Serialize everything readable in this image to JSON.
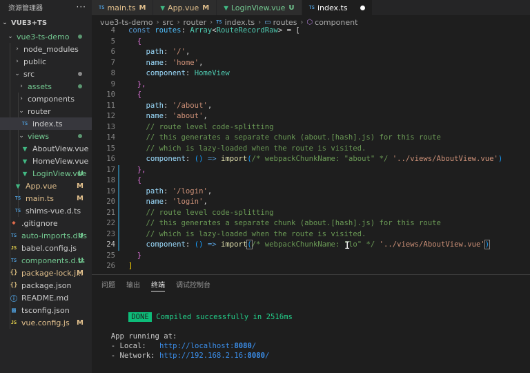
{
  "explorer": {
    "title": "资源管理器",
    "more": "···",
    "project": "VUE3+TS",
    "items": [
      {
        "label": "vue3-ts-demo",
        "status": "dot-green"
      },
      {
        "label": "node_modules"
      },
      {
        "label": "public"
      },
      {
        "label": "src",
        "status": "dot-gray"
      },
      {
        "label": "assets",
        "status": "dot-green"
      },
      {
        "label": "components"
      },
      {
        "label": "router"
      },
      {
        "label": "index.ts",
        "icon": "TS"
      },
      {
        "label": "views",
        "status": "dot-green"
      },
      {
        "label": "AboutView.vue"
      },
      {
        "label": "HomeView.vue"
      },
      {
        "label": "LoginView.vue",
        "badge": "U"
      },
      {
        "label": "App.vue",
        "badge": "M"
      },
      {
        "label": "main.ts",
        "icon": "TS",
        "badge": "M"
      },
      {
        "label": "shims-vue.d.ts",
        "icon": "TS"
      },
      {
        "label": ".gitignore"
      },
      {
        "label": "auto-imports.d.ts",
        "icon": "TS",
        "badge": "U"
      },
      {
        "label": "babel.config.js",
        "icon": "JS"
      },
      {
        "label": "components.d.ts",
        "icon": "TS",
        "badge": "U"
      },
      {
        "label": "package-lock.j...",
        "icon": "{}",
        "badge": "M"
      },
      {
        "label": "package.json",
        "icon": "{}"
      },
      {
        "label": "README.md"
      },
      {
        "label": "tsconfig.json"
      },
      {
        "label": "vue.config.js",
        "icon": "JS",
        "badge": "M"
      }
    ]
  },
  "tabs": [
    {
      "label": "main.ts",
      "icon": "TS",
      "badge": "M"
    },
    {
      "label": "App.vue",
      "badge": "M"
    },
    {
      "label": "LoginView.vue",
      "badge": "U"
    },
    {
      "label": "index.ts",
      "icon": "TS",
      "active": true
    }
  ],
  "breadcrumb": [
    "vue3-ts-demo",
    "src",
    "router",
    "index.ts",
    "routes",
    "component"
  ],
  "code": {
    "line_numbers": [
      "4",
      "5",
      "6",
      "7",
      "8",
      "9",
      "10",
      "11",
      "12",
      "13",
      "14",
      "15",
      "16",
      "17",
      "18",
      "19",
      "20",
      "21",
      "22",
      "23",
      "24",
      "25",
      "26"
    ],
    "lines": {
      "l4_a": "const",
      "l4_b": "routes",
      "l4_c": ": ",
      "l4_d": "Array",
      "l4_e": "<",
      "l4_f": "RouteRecordRaw",
      "l4_g": "> = [",
      "l5": "{",
      "l6_k": "path",
      "l6_v": "'/'",
      "l7_k": "name",
      "l7_v": "'home'",
      "l8_k": "component",
      "l8_v": "HomeView",
      "l9": "},",
      "l10": "{",
      "l11_k": "path",
      "l11_v": "'/about'",
      "l12_k": "name",
      "l12_v": "'about'",
      "l13": "// route level code-splitting",
      "l14": "// this generates a separate chunk (about.[hash].js) for this route",
      "l15": "// which is lazy-loaded when the route is visited.",
      "l16_k": "component",
      "l16_arrow": "=>",
      "l16_fn": "import",
      "l16_cmt": "/* webpackChunkName: \"about\" */",
      "l16_str": "'../views/AboutView.vue'",
      "l17": "},",
      "l18": "{",
      "l19_k": "path",
      "l19_v": "'/login'",
      "l20_k": "name",
      "l20_v": "'login'",
      "l21": "// route level code-splitting",
      "l22": "// this generates a separate chunk (about.[hash].js) for this route",
      "l23": "// which is lazy-loaded when the route is visited.",
      "l24_k": "component",
      "l24_arrow": "=>",
      "l24_fn": "import",
      "l24_cmt": "/* webpackChunkName: \"lo\" */",
      "l24_str": "'../views/AboutView.vue'",
      "l25": "}",
      "l26": "]"
    }
  },
  "panel": {
    "tabs": [
      "问题",
      "输出",
      "终端",
      "调试控制台"
    ],
    "active_tab": "终端",
    "terminal": {
      "done": "DONE",
      "compiled": "Compiled successfully in 2516ms",
      "app_running": "App running at:",
      "local_label": "- Local:   ",
      "local_url_a": "http://localhost:",
      "local_port": "8080",
      "local_url_b": "/",
      "network_label": "- Network: ",
      "network_url_a": "http://192.168.2.16:",
      "network_port": "8080",
      "network_url_b": "/"
    }
  },
  "colors": {
    "modified": "#e2c08d",
    "untracked": "#73c991",
    "ts": "#4e9bd6",
    "vue": "#41b883"
  }
}
